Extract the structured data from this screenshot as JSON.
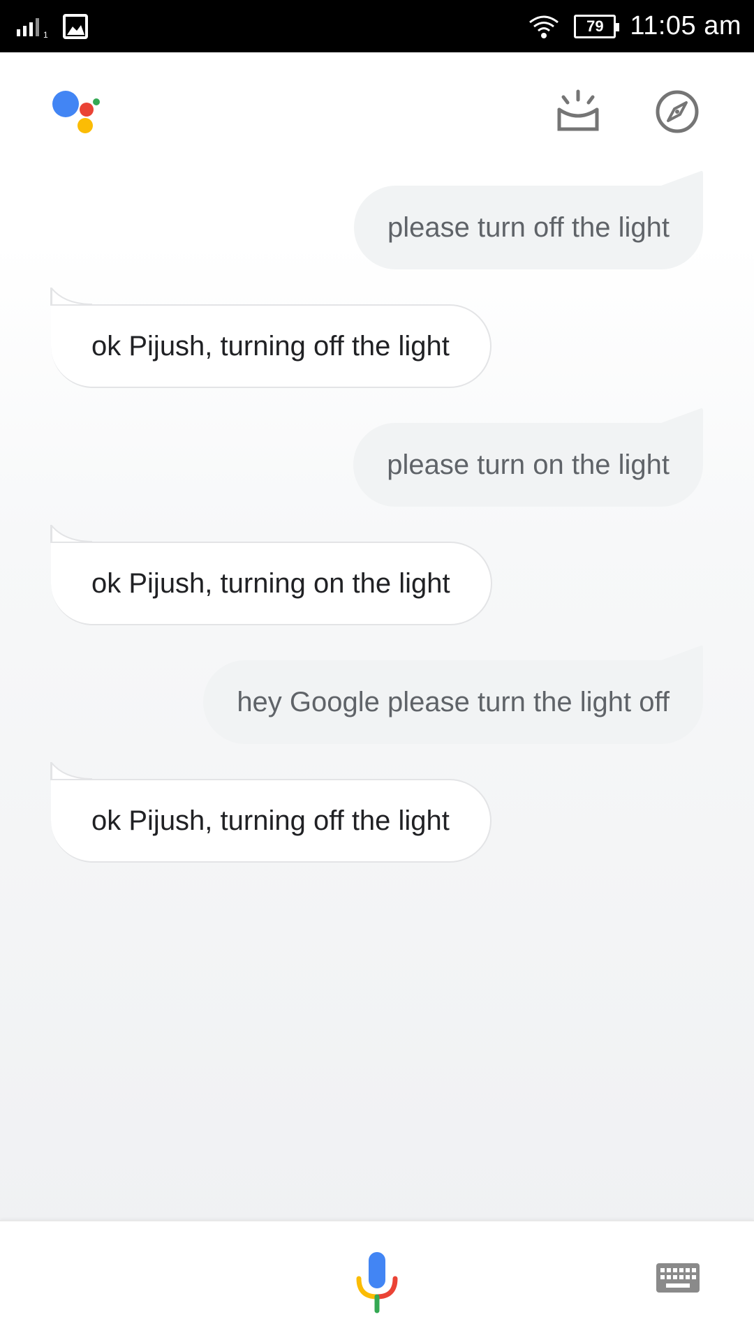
{
  "status_bar": {
    "time": "11:05 am",
    "battery": "79",
    "sim_slot": "1",
    "icons": [
      "signal-icon",
      "image-notification-icon",
      "wifi-icon",
      "battery-icon"
    ]
  },
  "header": {
    "icons": [
      "google-assistant-logo",
      "updates-icon",
      "explore-icon"
    ]
  },
  "conversation": [
    {
      "role": "user",
      "text": "please turn off the light"
    },
    {
      "role": "assistant",
      "text": "ok Pijush, turning off the light"
    },
    {
      "role": "user",
      "text": "please turn on the light"
    },
    {
      "role": "assistant",
      "text": "ok Pijush, turning on the light"
    },
    {
      "role": "user",
      "text": "hey Google please turn the light off"
    },
    {
      "role": "assistant",
      "text": "ok Pijush, turning off the light"
    }
  ],
  "bottom_bar": {
    "icons": [
      "mic-icon",
      "keyboard-icon"
    ]
  },
  "colors": {
    "google_blue": "#4285f4",
    "google_red": "#ea4335",
    "google_yellow": "#fbbc05",
    "google_green": "#34a853",
    "user_bubble": "#f1f3f4",
    "icon_gray": "#757575"
  }
}
